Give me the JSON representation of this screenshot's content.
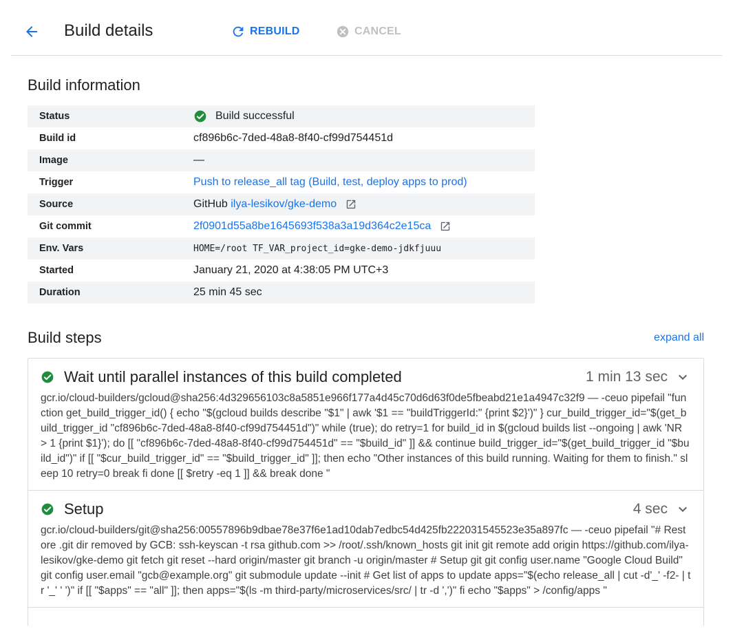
{
  "header": {
    "title": "Build details",
    "rebuild_label": "REBUILD",
    "cancel_label": "CANCEL"
  },
  "colors": {
    "accent": "#1a73e8",
    "success": "#1e8e3e",
    "disabled": "#bdc1c6"
  },
  "build_info": {
    "title": "Build information",
    "rows": {
      "status": {
        "label": "Status",
        "value": "Build successful"
      },
      "build_id": {
        "label": "Build id",
        "value": "cf896b6c-7ded-48a8-8f40-cf99d754451d"
      },
      "image": {
        "label": "Image",
        "value": "—"
      },
      "trigger": {
        "label": "Trigger",
        "value": "Push to release_all tag (Build, test, deploy apps to prod)"
      },
      "source": {
        "label": "Source",
        "prefix": "GitHub",
        "value": "ilya-lesikov/gke-demo"
      },
      "git_commit": {
        "label": "Git commit",
        "value": "2f0901d55a8be1645693f538a3a19d364c2e15ca"
      },
      "env_vars": {
        "label": "Env. Vars",
        "value": "HOME=/root TF_VAR_project_id=gke-demo-jdkfjuuu"
      },
      "started": {
        "label": "Started",
        "value": "January 21, 2020 at 4:38:05 PM UTC+3"
      },
      "duration": {
        "label": "Duration",
        "value": "25 min 45 sec"
      }
    }
  },
  "build_steps": {
    "title": "Build steps",
    "expand_all_label": "expand all",
    "steps": [
      {
        "name": "Wait until parallel instances of this build completed",
        "duration": "1 min 13 sec",
        "command": "gcr.io/cloud-builders/gcloud@sha256:4d329656103c8a5851e966f177a4d45c70d6d63f0de5fbeabd21e1a4947c32f9 — -ceuo pipefail \"function get_build_trigger_id() { echo \"$(gcloud builds describe \"$1\" | awk '$1 == \"buildTriggerId:\" {print $2}')\" } cur_build_trigger_id=\"$(get_build_trigger_id \"cf896b6c-7ded-48a8-8f40-cf99d754451d\")\" while (true); do retry=1 for build_id in $(gcloud builds list --ongoing | awk 'NR > 1 {print $1}'); do [[ \"cf896b6c-7ded-48a8-8f40-cf99d754451d\" == \"$build_id\" ]] && continue build_trigger_id=\"$(get_build_trigger_id \"$build_id\")\" if [[ \"$cur_build_trigger_id\" == \"$build_trigger_id\" ]]; then echo \"Other instances of this build running. Waiting for them to finish.\" sleep 10 retry=0 break fi done [[ $retry -eq 1 ]] && break done \""
      },
      {
        "name": "Setup",
        "duration": "4 sec",
        "command": "gcr.io/cloud-builders/git@sha256:00557896b9dbae78e37f6e1ad10dab7edbc54d425fb222031545523e35a897fc — -ceuo pipefail \"# Restore .git dir removed by GCB: ssh-keyscan -t rsa github.com >> /root/.ssh/known_hosts git init git remote add origin https://github.com/ilya-lesikov/gke-demo git fetch git reset --hard origin/master git branch -u origin/master # Setup git git config user.name \"Google Cloud Build\" git config user.email \"gcb@example.org\" git submodule update --init # Get list of apps to update apps=\"$(echo release_all | cut -d'_' -f2- | tr '_' ' ')\" if [[ \"$apps\" == \"all\" ]]; then apps=\"$(ls -m third-party/microservices/src/ | tr -d ',')\" fi echo \"$apps\" > /config/apps \""
      }
    ]
  }
}
